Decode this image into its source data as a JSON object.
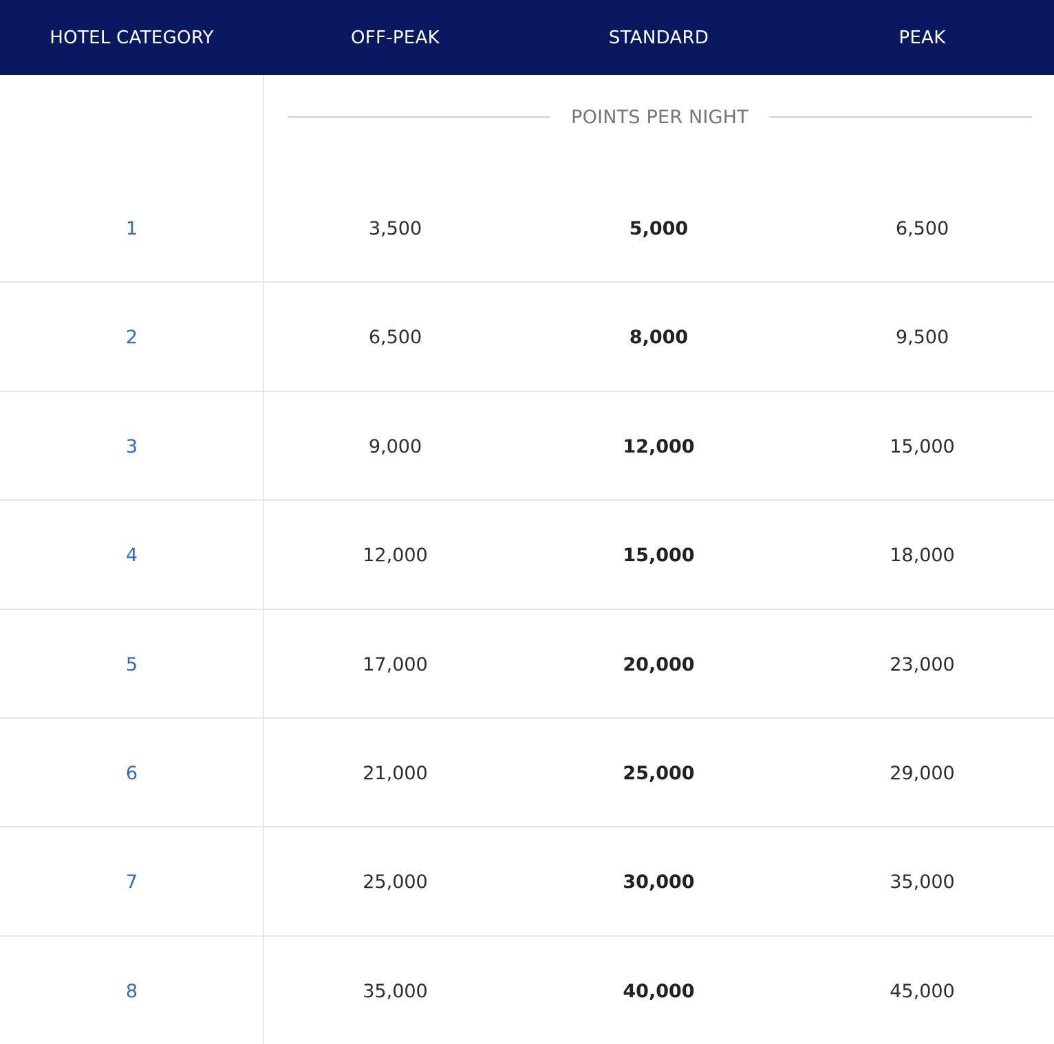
{
  "header": {
    "columns": [
      "HOTEL CATEGORY",
      "OFF-PEAK",
      "STANDARD",
      "PEAK"
    ]
  },
  "subheader": {
    "label": "POINTS PER NIGHT"
  },
  "rows": [
    {
      "category": "1",
      "off_peak": "3,500",
      "standard": "5,000",
      "peak": "6,500"
    },
    {
      "category": "2",
      "off_peak": "6,500",
      "standard": "8,000",
      "peak": "9,500"
    },
    {
      "category": "3",
      "off_peak": "9,000",
      "standard": "12,000",
      "peak": "15,000"
    },
    {
      "category": "4",
      "off_peak": "12,000",
      "standard": "15,000",
      "peak": "18,000"
    },
    {
      "category": "5",
      "off_peak": "17,000",
      "standard": "20,000",
      "peak": "23,000"
    },
    {
      "category": "6",
      "off_peak": "21,000",
      "standard": "25,000",
      "peak": "29,000"
    },
    {
      "category": "7",
      "off_peak": "25,000",
      "standard": "30,000",
      "peak": "35,000"
    },
    {
      "category": "8",
      "off_peak": "35,000",
      "standard": "40,000",
      "peak": "45,000"
    }
  ],
  "colors": {
    "header_background": "#0a185f",
    "category_text": "#2f6cc1",
    "value_text": "#2e2e2e"
  }
}
